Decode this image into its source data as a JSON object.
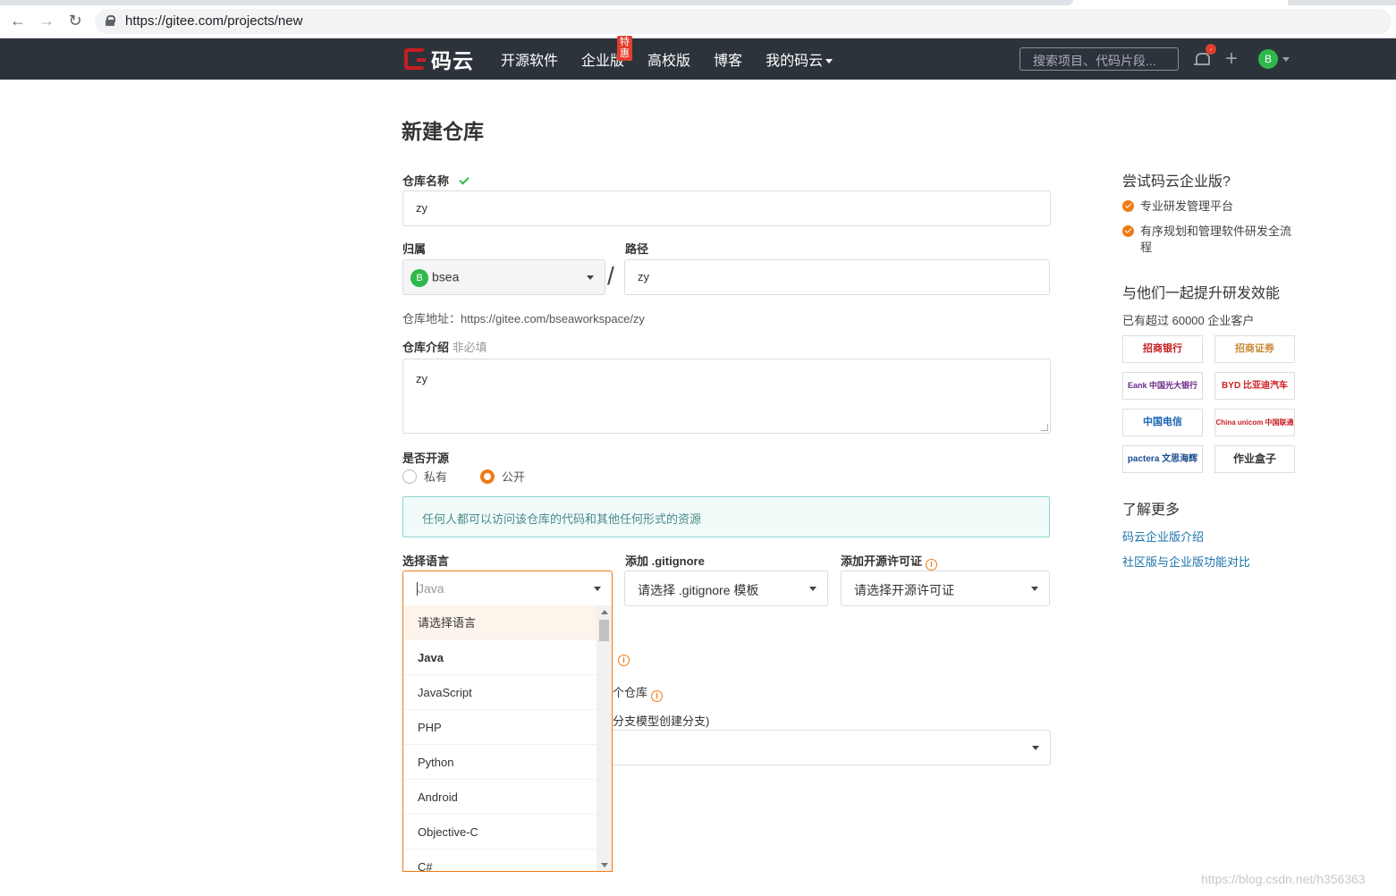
{
  "browser": {
    "url": "https://gitee.com/projects/new"
  },
  "header": {
    "logo_text": "码云",
    "nav": [
      "开源软件",
      "企业版",
      "高校版",
      "博客",
      "我的码云"
    ],
    "hot_badge": "特惠",
    "search_placeholder": "搜索项目、代码片段...",
    "bell_count": "-",
    "avatar_letter": "B"
  },
  "form": {
    "title": "新建仓库",
    "name_label": "仓库名称",
    "name_value": "zy",
    "owner_label": "归属",
    "owner_avatar": "B",
    "owner_value": "bsea",
    "path_label": "路径",
    "path_value": "zy",
    "address_text": "仓库地址：https://gitee.com/bseaworkspace/zy",
    "intro_label": "仓库介绍",
    "intro_optional": "非必填",
    "intro_value": "zy",
    "open_label": "是否开源",
    "private_label": "私有",
    "public_label": "公开",
    "notice": "任何人都可以访问该仓库的代码和其他任何形式的资源",
    "lang_label": "选择语言",
    "lang_placeholder": "Java",
    "gitignore_label": "添加 .gitignore",
    "gitignore_value": "请选择 .gitignore 模板",
    "license_label": "添加开源许可证",
    "license_value": "请选择开源许可证",
    "partial_1": "个仓库",
    "partial_2": "分支模型创建分支)"
  },
  "lang_options": [
    "请选择语言",
    "Java",
    "JavaScript",
    "PHP",
    "Python",
    "Android",
    "Objective-C",
    "C#"
  ],
  "sidebar": {
    "try_title": "尝试码云企业版?",
    "features": [
      "专业研发管理平台",
      "有序规划和管理软件研发全流程"
    ],
    "together_title": "与他们一起提升研发效能",
    "customers_text": "已有超过 60000 企业客户",
    "logos": [
      "招商银行",
      "招商证券",
      "Eank 中国光大银行",
      "BYD 比亚迪汽车",
      "中国电信",
      "China unicom 中国联通",
      "pactera 文思海辉",
      "作业盒子"
    ],
    "more_title": "了解更多",
    "links": [
      "码云企业版介绍",
      "社区版与企业版功能对比"
    ]
  },
  "watermark": "https://blog.csdn.net/h356363",
  "colors": {
    "accent": "#f07a14",
    "header_bg": "#2c333b",
    "link": "#1a73a8",
    "success": "#2eb84b"
  }
}
